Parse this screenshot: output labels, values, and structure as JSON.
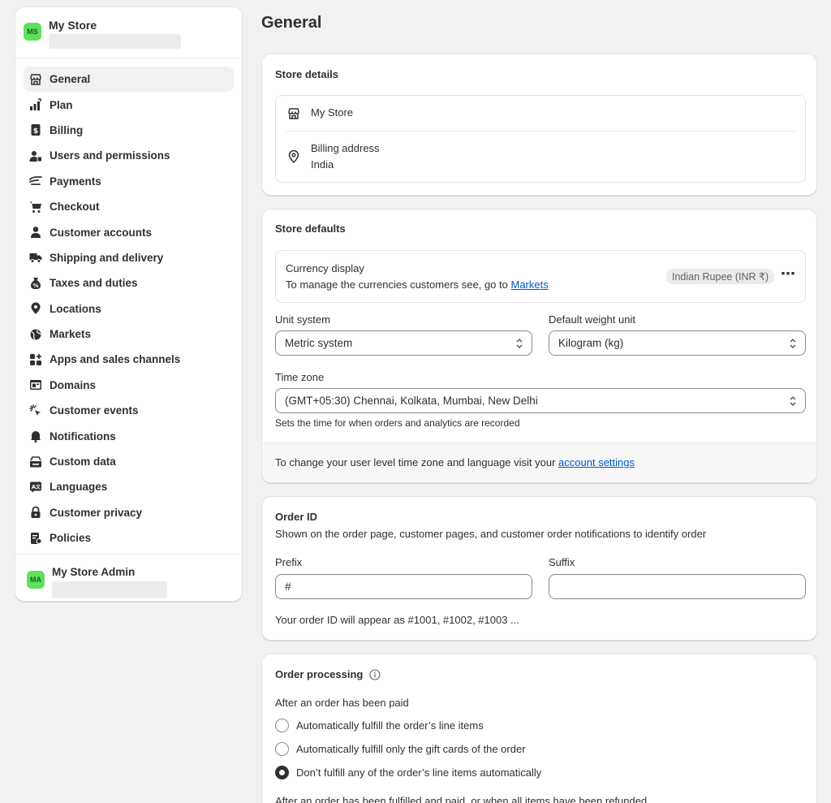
{
  "store": {
    "initials": "MS",
    "name": "My Store"
  },
  "nav": [
    {
      "label": "General",
      "icon": "store-icon",
      "active": true
    },
    {
      "label": "Plan",
      "icon": "plan-icon"
    },
    {
      "label": "Billing",
      "icon": "billing-icon"
    },
    {
      "label": "Users and permissions",
      "icon": "users-icon"
    },
    {
      "label": "Payments",
      "icon": "payments-icon"
    },
    {
      "label": "Checkout",
      "icon": "cart-icon"
    },
    {
      "label": "Customer accounts",
      "icon": "person-icon"
    },
    {
      "label": "Shipping and delivery",
      "icon": "truck-icon"
    },
    {
      "label": "Taxes and duties",
      "icon": "tax-bag-icon"
    },
    {
      "label": "Locations",
      "icon": "location-icon"
    },
    {
      "label": "Markets",
      "icon": "globe-icon"
    },
    {
      "label": "Apps and sales channels",
      "icon": "apps-icon"
    },
    {
      "label": "Domains",
      "icon": "domains-icon"
    },
    {
      "label": "Customer events",
      "icon": "cursor-click-icon"
    },
    {
      "label": "Notifications",
      "icon": "bell-icon"
    },
    {
      "label": "Custom data",
      "icon": "custom-data-icon"
    },
    {
      "label": "Languages",
      "icon": "languages-icon"
    },
    {
      "label": "Customer privacy",
      "icon": "lock-icon"
    },
    {
      "label": "Policies",
      "icon": "policies-icon"
    }
  ],
  "admin": {
    "initials": "MA",
    "name": "My Store Admin"
  },
  "page": {
    "title": "General"
  },
  "store_details": {
    "title": "Store details",
    "store_name": "My Store",
    "billing_label": "Billing address",
    "billing_value": "India"
  },
  "store_defaults": {
    "title": "Store defaults",
    "currency_label": "Currency display",
    "currency_help": "To manage the currencies customers see, go to ",
    "currency_link": "Markets",
    "currency_badge": "Indian Rupee (INR ₹)",
    "more_icon": "⋯",
    "unit_label": "Unit system",
    "unit_value": "Metric system",
    "weight_label": "Default weight unit",
    "weight_value": "Kilogram (kg)",
    "tz_label": "Time zone",
    "tz_value": "(GMT+05:30) Chennai, Kolkata, Mumbai, New Delhi",
    "tz_help": "Sets the time for when orders and analytics are recorded",
    "footer_text": "To change your user level time zone and language visit your ",
    "footer_link": "account settings"
  },
  "order_id": {
    "title": "Order ID",
    "desc": "Shown on the order page, customer pages, and customer order notifications to identify order",
    "prefix_label": "Prefix",
    "prefix_value": "#",
    "suffix_label": "Suffix",
    "suffix_value": "",
    "preview": "Your order ID will appear as #1001, #1002, #1003 ..."
  },
  "order_processing": {
    "title": "Order processing",
    "paid_label": "After an order has been paid",
    "options": [
      {
        "label": "Automatically fulfill the order’s line items",
        "checked": false
      },
      {
        "label": "Automatically fulfill only the gift cards of the order",
        "checked": false
      },
      {
        "label": "Don’t fulfill any of the order’s line items automatically",
        "checked": true
      }
    ],
    "fulfilled_label": "After an order has been fulfilled and paid, or when all items have been refunded"
  }
}
